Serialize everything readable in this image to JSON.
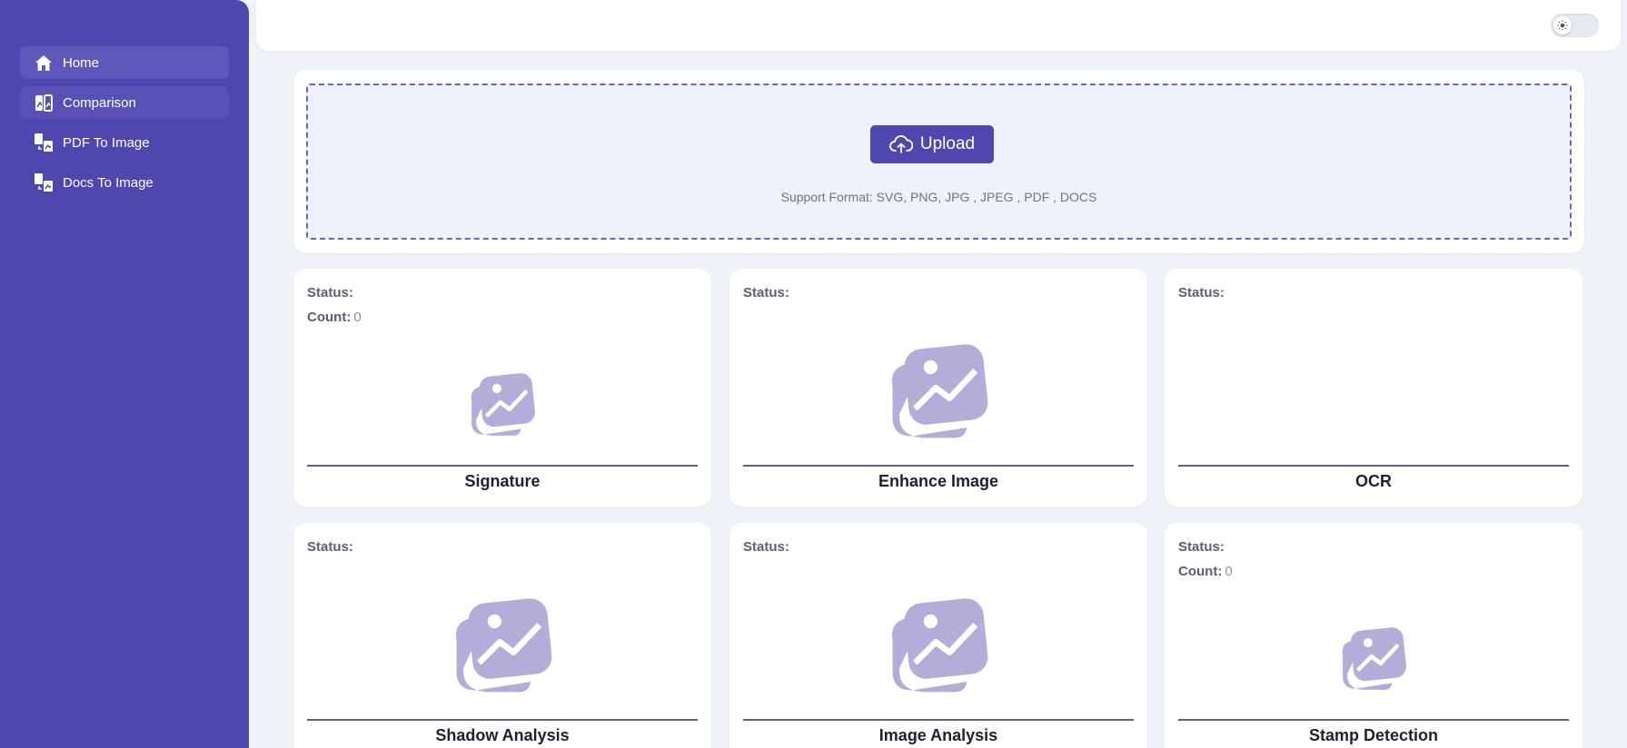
{
  "sidebar": {
    "items": [
      {
        "label": "Home",
        "icon": "home-icon"
      },
      {
        "label": "Comparison",
        "icon": "comparison-icon"
      },
      {
        "label": "PDF To Image",
        "icon": "pdf-to-image-icon"
      },
      {
        "label": "Docs To Image",
        "icon": "docs-to-image-icon"
      }
    ]
  },
  "topbar": {
    "theme_toggle_icon": "sun-icon"
  },
  "upload": {
    "button_label": "Upload",
    "button_icon": "cloud-upload-icon",
    "support_text": "Support Format: SVG, PNG, JPG , JPEG , PDF , DOCS"
  },
  "cards": [
    {
      "title": "Signature",
      "status_label": "Status:",
      "count_label": "Count:",
      "count_value": "0",
      "icon": "image-placeholder-icon"
    },
    {
      "title": "Enhance Image",
      "status_label": "Status:",
      "icon": "image-placeholder-icon"
    },
    {
      "title": "OCR",
      "status_label": "Status:"
    },
    {
      "title": "Shadow Analysis",
      "status_label": "Status:",
      "icon": "image-placeholder-icon"
    },
    {
      "title": "Image Analysis",
      "status_label": "Status:",
      "icon": "image-placeholder-icon"
    },
    {
      "title": "Stamp Detection",
      "status_label": "Status:",
      "count_label": "Count:",
      "count_value": "0",
      "icon": "image-placeholder-icon"
    }
  ],
  "colors": {
    "sidebar": "#4f47ae",
    "accent": "#4f47ae",
    "placeholder_icon": "#b3aed9",
    "background": "#eff2f7"
  }
}
